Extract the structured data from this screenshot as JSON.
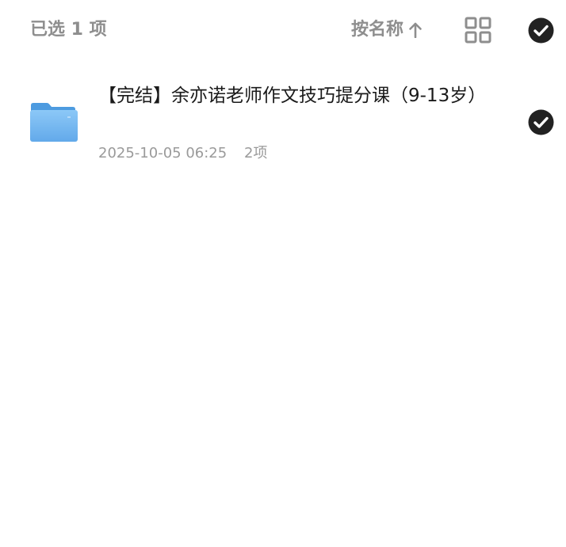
{
  "header": {
    "selected_count_label": "已选 1 项",
    "sort_label": "按名称",
    "sort_direction_icon": "arrow-up-icon",
    "view_toggle_icon": "grid-view-icon",
    "select_all_icon": "check-circle-icon"
  },
  "files": [
    {
      "icon": "folder-icon",
      "name": "【完结】余亦诺老师作文技巧提分课（9-13岁）",
      "date": "2025-10-05 06:25",
      "item_count": "2项",
      "selected": true
    }
  ],
  "colors": {
    "muted_text": "#8e8e8e",
    "meta_text": "#9a9a9a",
    "title_text": "#1a1a1a",
    "check_fill": "#222222",
    "folder_blue": "#6fb3ee"
  }
}
